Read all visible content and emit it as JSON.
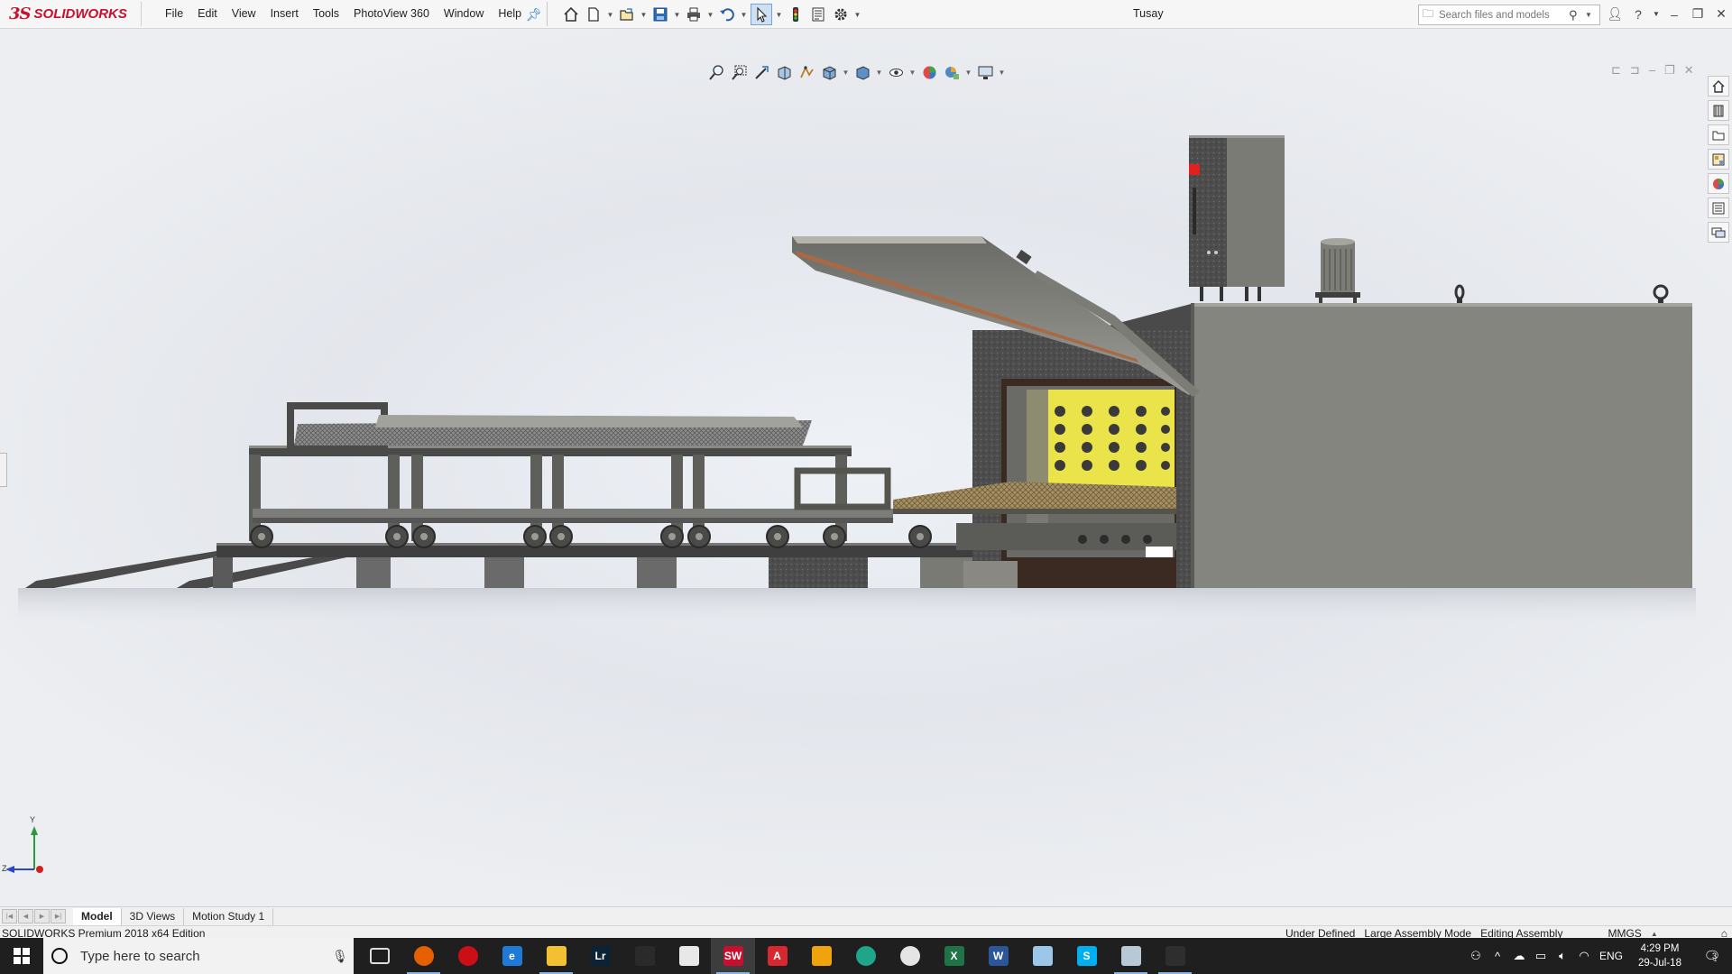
{
  "app": {
    "logo_mark": "3S",
    "logo_text": "SOLIDWORKS",
    "document_title": "Tusay"
  },
  "menu": {
    "items": [
      "File",
      "Edit",
      "View",
      "Insert",
      "Tools",
      "PhotoView 360",
      "Window",
      "Help"
    ]
  },
  "quick_toolbar": {
    "icons": [
      "home-icon",
      "new-document-icon",
      "open-folder-icon",
      "save-icon",
      "print-icon",
      "undo-icon",
      "select-arrow-icon",
      "rebuild-traffic-light-icon",
      "file-properties-icon",
      "options-gear-icon"
    ]
  },
  "search": {
    "placeholder": "Search files and models"
  },
  "view_toolbar": {
    "icons": [
      "zoom-to-fit-icon",
      "zoom-to-area-icon",
      "previous-view-icon",
      "section-view-icon",
      "dynamic-annotation-icon",
      "view-orientation-icon",
      "display-style-icon",
      "hide-show-items-icon",
      "edit-appearance-icon",
      "apply-scene-icon",
      "view-settings-icon"
    ]
  },
  "task_pane": {
    "icons": [
      "solidworks-resources-icon",
      "design-library-icon",
      "file-explorer-icon",
      "view-palette-icon",
      "appearances-icon",
      "custom-properties-icon",
      "forum-icon"
    ]
  },
  "triad": {
    "y_label": "Y",
    "z_label": "Z"
  },
  "tabs": {
    "items": [
      "Model",
      "3D Views",
      "Motion Study 1"
    ],
    "active": "Model"
  },
  "status": {
    "edition": "SOLIDWORKS Premium 2018 x64 Edition",
    "definition": "Under Defined",
    "mode": "Large Assembly Mode",
    "editing": "Editing Assembly",
    "units": "MMGS"
  },
  "taskbar": {
    "search_placeholder": "Type here to search",
    "apps": [
      {
        "name": "task-view",
        "label": "",
        "color": "#1f1f1f"
      },
      {
        "name": "firefox",
        "label": "",
        "color": "#e66000"
      },
      {
        "name": "opera",
        "label": "",
        "color": "#cc0f16"
      },
      {
        "name": "edge",
        "label": "e",
        "color": "#1e7ad6"
      },
      {
        "name": "file-explorer",
        "label": "",
        "color": "#f3c02f"
      },
      {
        "name": "lightroom",
        "label": "Lr",
        "color": "#0c2235"
      },
      {
        "name": "store",
        "label": "",
        "color": "#2a2a2a"
      },
      {
        "name": "mail",
        "label": "",
        "color": "#e8e8e8"
      },
      {
        "name": "solidworks",
        "label": "SW",
        "color": "#c8102e"
      },
      {
        "name": "acrobat",
        "label": "A",
        "color": "#d7282f"
      },
      {
        "name": "app-orange",
        "label": "",
        "color": "#f0a30a"
      },
      {
        "name": "app-teal",
        "label": "",
        "color": "#1fa58a"
      },
      {
        "name": "app-globe",
        "label": "",
        "color": "#e5e5e5"
      },
      {
        "name": "excel",
        "label": "X",
        "color": "#1f7346"
      },
      {
        "name": "word",
        "label": "W",
        "color": "#2b579a"
      },
      {
        "name": "app-notes",
        "label": "",
        "color": "#9cc7e9"
      },
      {
        "name": "skype",
        "label": "S",
        "color": "#00aff0"
      },
      {
        "name": "app-tools",
        "label": "",
        "color": "#b7c9d6"
      },
      {
        "name": "photos",
        "label": "",
        "color": "#2e2e2e"
      }
    ],
    "language": "ENG",
    "time": "4:29 PM",
    "date": "29-Jul-18",
    "notification_count": "3"
  }
}
